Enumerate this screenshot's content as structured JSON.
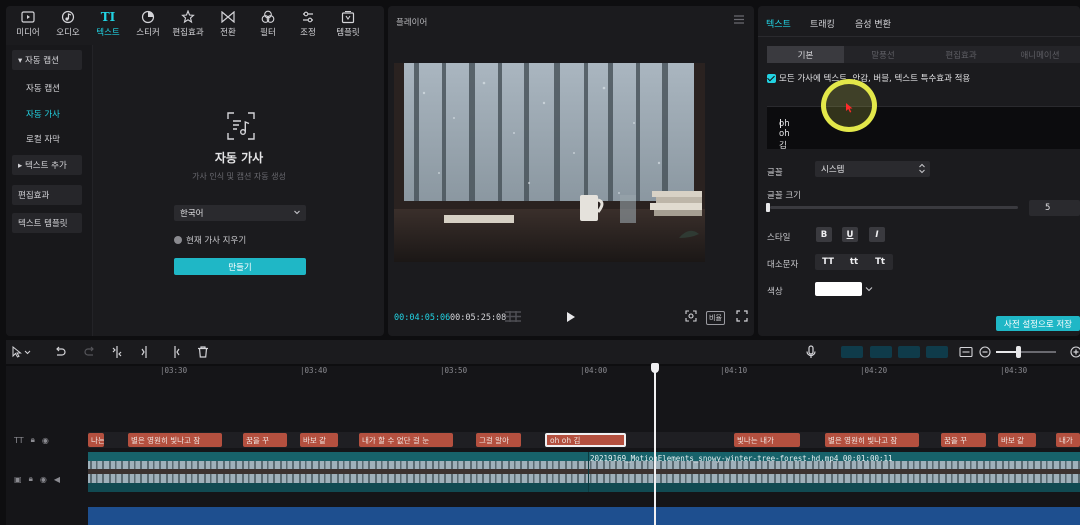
{
  "toolbar": {
    "tools": [
      {
        "label": "미디어",
        "icon": "media-icon"
      },
      {
        "label": "오디오",
        "icon": "audio-icon"
      },
      {
        "label": "텍스트",
        "icon": "text-icon"
      },
      {
        "label": "스티커",
        "icon": "sticker-icon"
      },
      {
        "label": "편집효과",
        "icon": "effects-icon"
      },
      {
        "label": "전환",
        "icon": "transition-icon"
      },
      {
        "label": "필터",
        "icon": "filter-icon"
      },
      {
        "label": "조정",
        "icon": "adjust-icon"
      },
      {
        "label": "템플릿",
        "icon": "template-icon"
      }
    ],
    "active": "텍스트"
  },
  "sidenav": {
    "section_auto": "▾ 자동 캡션",
    "item_caption": "자동 캡션",
    "item_lyrics": "자동 가사",
    "item_local": "로컬 자막",
    "section_add": "▸ 텍스트 추가",
    "item_effect": "편집효과",
    "item_template": "텍스트 템플릿"
  },
  "lyrics": {
    "title": "자동 가사",
    "description": "가사 인식 및 캡션 자동 생성",
    "language": "한국어",
    "clear_option": "현재 가사 지우기",
    "button": "만들기"
  },
  "player": {
    "title": "플레이어",
    "current_time": "00:04:05:06",
    "total_time": "00:05:25:08",
    "ratio": "비율"
  },
  "inspector": {
    "tabs": [
      "텍스트",
      "트래킹",
      "음성 변환"
    ],
    "subtabs": [
      "기본",
      "말풍선",
      "편집효과",
      "애니메이션"
    ],
    "apply_all": "모든 가사에 텍스트, 안감, 버블, 텍스트 특수효과 적용",
    "text_value": "oh oh 김",
    "font_label": "글꼴",
    "font_value": "시스템",
    "size_label": "글꼴 크기",
    "size_value": "5",
    "size_fraction": 0.0,
    "style_label": "스타일",
    "style_buttons": [
      "B",
      "U",
      "I"
    ],
    "case_label": "대소문자",
    "case_buttons": [
      "TT",
      "tt",
      "Tt"
    ],
    "color_label": "색상",
    "color_value": "#ffffff",
    "preset_button": "사전 설정으로 저장"
  },
  "timeline": {
    "ruler": [
      "|03:30",
      "|03:40",
      "|03:50",
      "|04:00",
      "|04:10",
      "|04:20",
      "|04:30"
    ],
    "text_track_label": "TT",
    "text_clips": [
      "나는",
      "별은 영원히 빛나고 잠",
      "꿈을 꾸",
      "바보 같",
      "내가 할 수 없단 걸 눈",
      "그걸 알아",
      "oh oh 김",
      "빛나는 내가",
      "별은 영원히 빛나고 잠",
      "꿈을 꾸",
      "바보 같",
      "내가"
    ],
    "selected_clip": "oh oh 김",
    "video_label": "20219169_MotionElements_snowy-winter-tree-forest-hd.mp4  00:01:00:11"
  },
  "colors": {
    "accent": "#22d3e3",
    "clip": "#b4503f",
    "video_track": "#17626a",
    "highlight": "#e3e84a"
  }
}
